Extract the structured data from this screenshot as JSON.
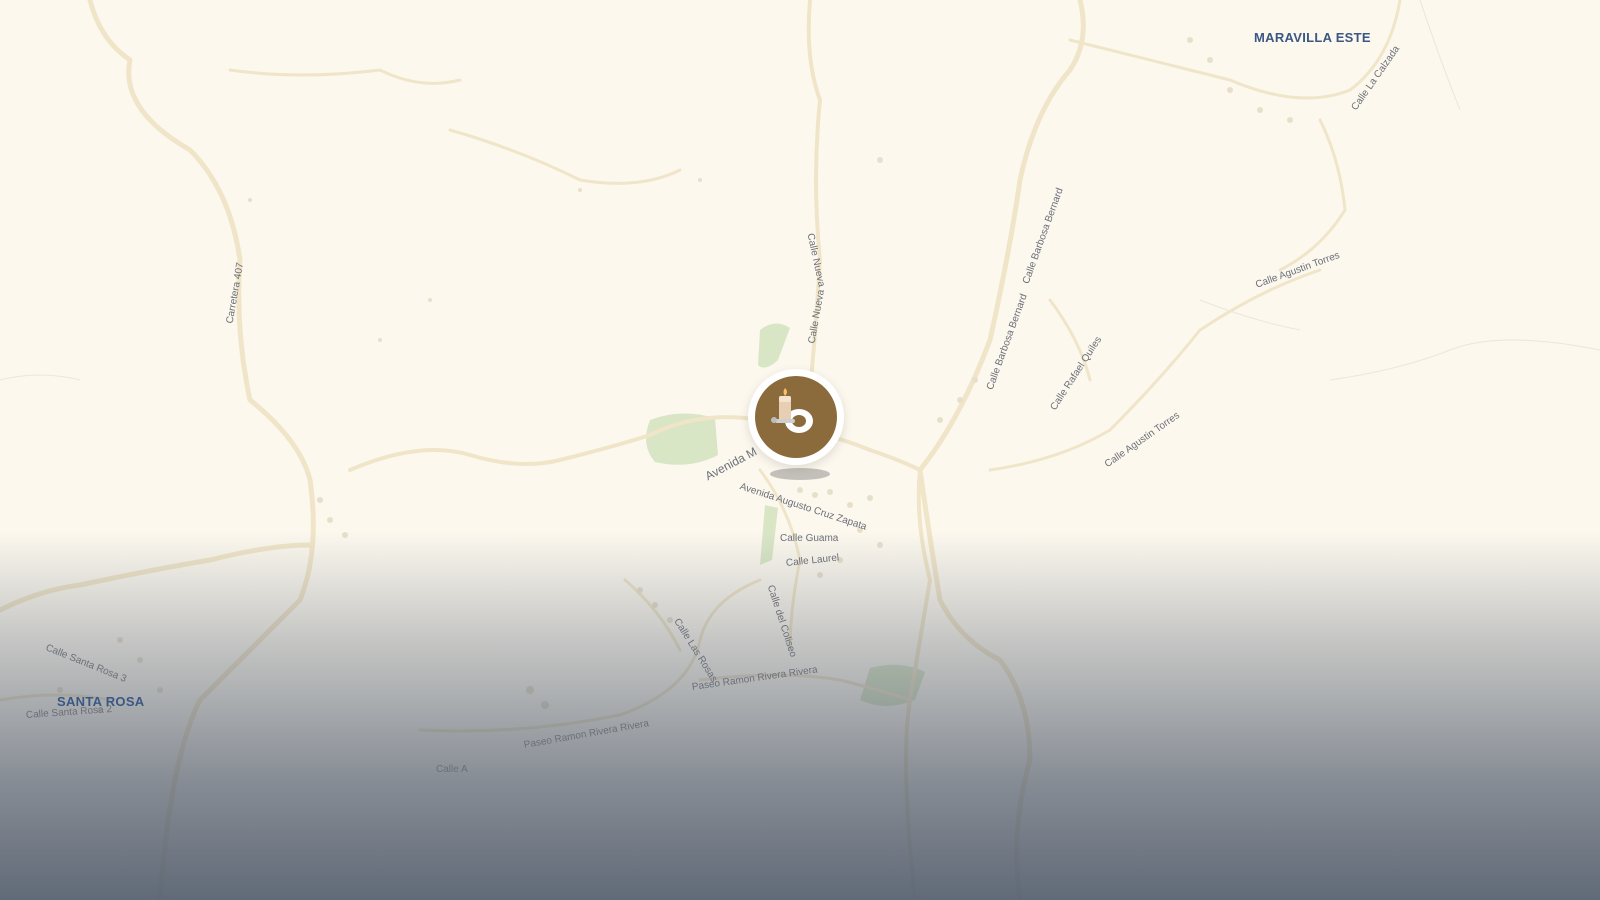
{
  "map": {
    "areas": [
      {
        "id": "maravilla-este",
        "label": "MARAVILLA ESTE"
      },
      {
        "id": "santa-rosa",
        "label": "SANTA ROSA"
      }
    ],
    "streets": [
      "Carretera 407",
      "Calle Nueva",
      "Calle Nueva",
      "Calle Barbosa Bernard",
      "Calle Barbosa Bernard",
      "Calle Rafael Quiles",
      "Calle Agustin Torres",
      "Calle Agustin Torres",
      "Calle La Calzada",
      "Avenida M",
      "Avenida Augusto Cruz Zapata",
      "Calle Guama",
      "Calle Laurel",
      "Calle del Coliseo",
      "Calle Las Rosas",
      "Paseo Ramon Rivera Rivera",
      "Paseo Ramon Rivera Rivera",
      "Calle A",
      "Calle Santa Rosa 3",
      "Calle Santa Rosa 2"
    ]
  },
  "marker": {
    "icon": "candle-icon",
    "accent_color": "#8b6b3c"
  },
  "colors": {
    "land": "#fcf8ee",
    "road": "#f1e6c9",
    "park": "#d6e4c4",
    "label": "#3b5785"
  }
}
